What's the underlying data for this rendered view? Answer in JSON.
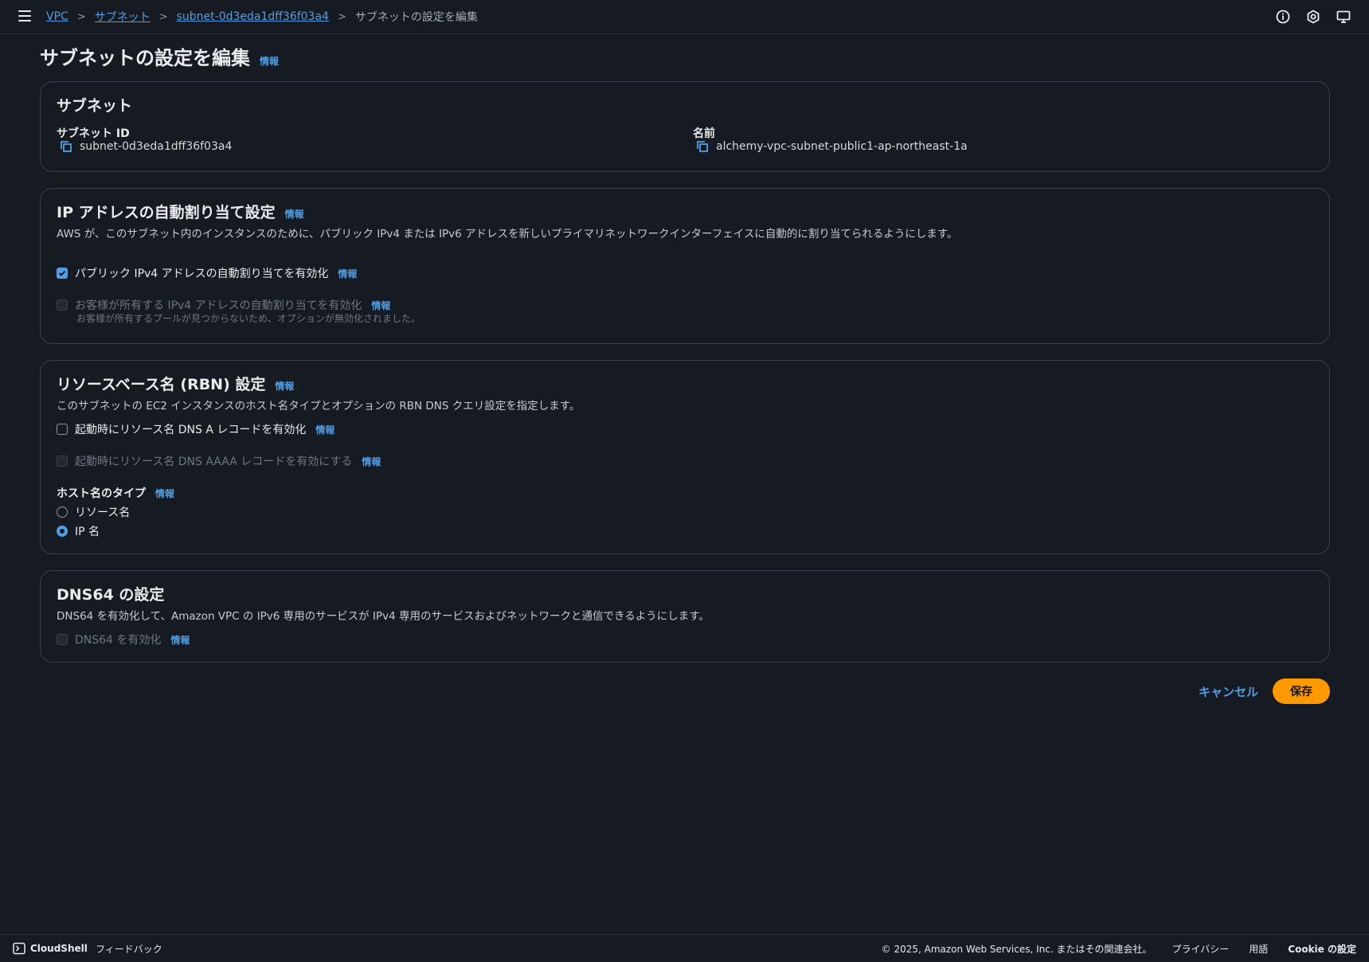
{
  "breadcrumb": {
    "items": [
      "VPC",
      "サブネット",
      "subnet-0d3eda1dff36f03a4"
    ],
    "current": "サブネットの設定を編集"
  },
  "page": {
    "title": "サブネットの設定を編集",
    "info": "情報"
  },
  "subnet_panel": {
    "title": "サブネット",
    "id_label": "サブネット ID",
    "id_value": "subnet-0d3eda1dff36f03a4",
    "name_label": "名前",
    "name_value": "alchemy-vpc-subnet-public1-ap-northeast-1a"
  },
  "ip_panel": {
    "title": "IP アドレスの自動割り当て設定",
    "info": "情報",
    "description": "AWS が、このサブネット内のインスタンスのために、パブリック IPv4 または IPv6 アドレスを新しいプライマリネットワークインターフェイスに自動的に割り当てられるようにします。",
    "public_ipv4_label": "パブリック IPv4 アドレスの自動割り当てを有効化",
    "public_ipv4_checked": true,
    "customer_ipv4_label": "お客様が所有する IPv4 アドレスの自動割り当てを有効化",
    "customer_ipv4_note": "お客様が所有するプールが見つからないため、オプションが無効化されました。"
  },
  "rbn_panel": {
    "title": "リソースベース名 (RBN) 設定",
    "info": "情報",
    "description": "このサブネットの EC2 インスタンスのホスト名タイプとオプションの RBN DNS クエリ設定を指定します。",
    "dns_a_label": "起動時にリソース名 DNS A レコードを有効化",
    "dns_aaaa_label": "起動時にリソース名 DNS AAAA レコードを有効にする",
    "hostname_label": "ホスト名のタイプ",
    "radio_resource": "リソース名",
    "radio_ip": "IP 名",
    "selected": "IP 名"
  },
  "dns64_panel": {
    "title": "DNS64 の設定",
    "description": "DNS64 を有効化して、Amazon VPC の IPv6 専用のサービスが IPv4 専用のサービスおよびネットワークと通信できるようにします。",
    "enable_label": "DNS64 を有効化",
    "info": "情報"
  },
  "actions": {
    "cancel": "キャンセル",
    "save": "保存"
  },
  "footer": {
    "cloudshell": "CloudShell",
    "feedback": "フィードバック",
    "copyright": "© 2025, Amazon Web Services, Inc. またはその関連会社。",
    "privacy": "プライバシー",
    "terms": "用語",
    "cookie": "Cookie の設定"
  },
  "colors": {
    "link": "#539fe5",
    "primary_button": "#ff9900",
    "background": "#161a22"
  }
}
